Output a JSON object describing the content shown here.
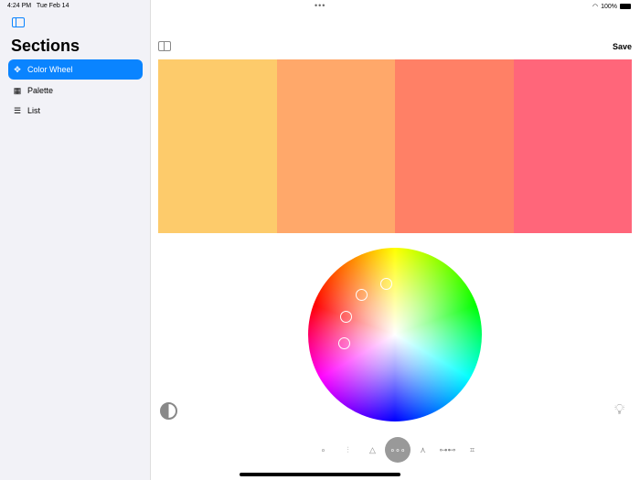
{
  "status": {
    "time": "4:24 PM",
    "date": "Tue Feb 14",
    "battery": "100%"
  },
  "sidebar": {
    "title": "Sections",
    "items": [
      {
        "label": "Color Wheel",
        "icon": "color-wheel-icon",
        "selected": true
      },
      {
        "label": "Palette",
        "icon": "grid-icon"
      },
      {
        "label": "List",
        "icon": "list-icon"
      }
    ]
  },
  "toolbar": {
    "save_label": "Save"
  },
  "palette": {
    "colors": [
      "#FDCB6B",
      "#FFA86A",
      "#FF8066",
      "#FF667A"
    ]
  },
  "modes": {
    "selected_index": 3,
    "items": [
      "single-icon",
      "complementary-icon",
      "triad-icon",
      "analogous-icon",
      "split-icon",
      "rectangle-icon",
      "square-icon"
    ]
  }
}
